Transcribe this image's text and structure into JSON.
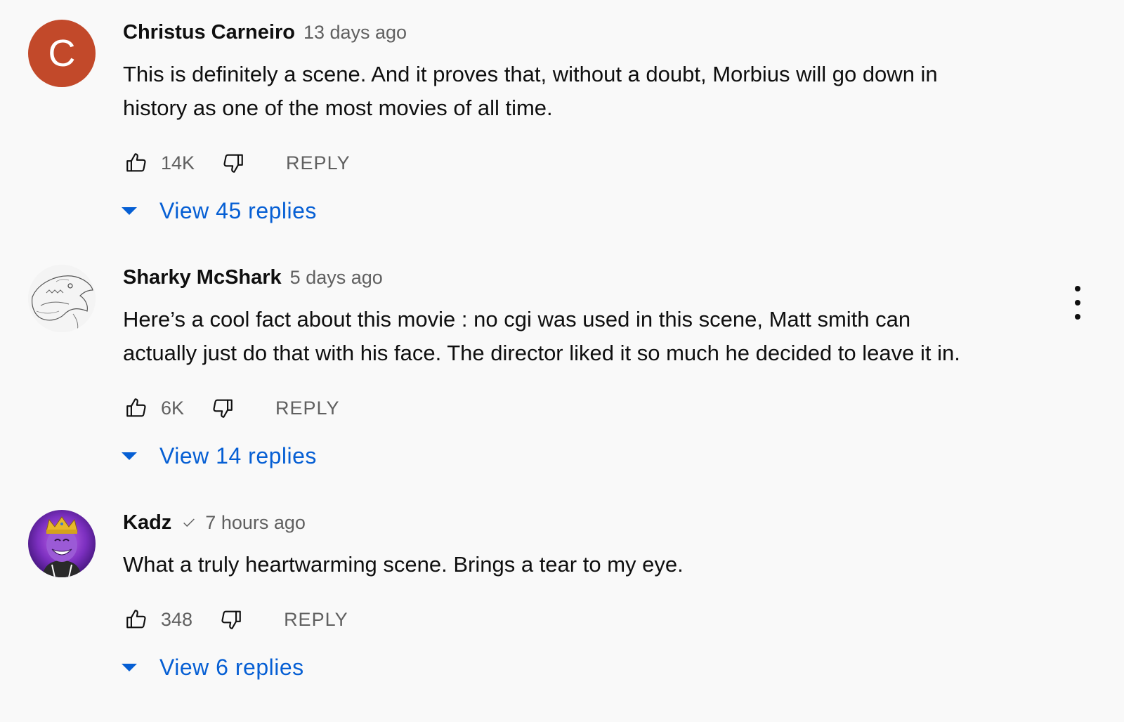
{
  "comments": [
    {
      "author": "Christus Carneiro",
      "avatar_letter": "C",
      "time": "13 days ago",
      "text": "This is definitely a scene. And it proves that, without a doubt, Morbius will go down in\nhistory as one of the most movies of all time.",
      "likes": "14K",
      "reply_label": "REPLY",
      "view_replies": "View 45 replies",
      "verified": false
    },
    {
      "author": "Sharky McShark",
      "time": "5 days ago",
      "text": "Here’s a cool fact about this movie : no cgi was used in this scene, Matt smith can\nactually just do that with his face. The director liked it so much he decided to leave it in.",
      "likes": "6K",
      "reply_label": "REPLY",
      "view_replies": "View 14 replies",
      "verified": false
    },
    {
      "author": "Kadz",
      "time": "7 hours ago",
      "text": "What a truly heartwarming scene. Brings a tear to my eye.",
      "likes": "348",
      "reply_label": "REPLY",
      "view_replies": "View 6 replies",
      "verified": true
    }
  ],
  "colors": {
    "background": "#f9f9f9",
    "link_blue": "#065fd4",
    "secondary_text": "#606060",
    "avatar_red": "#c2492a",
    "kadz_avatar_purple": "#7b2fbf"
  },
  "icons": [
    "thumbs-up-icon",
    "thumbs-down-icon",
    "caret-down-icon",
    "more-vert-icon",
    "verified-check-icon"
  ]
}
